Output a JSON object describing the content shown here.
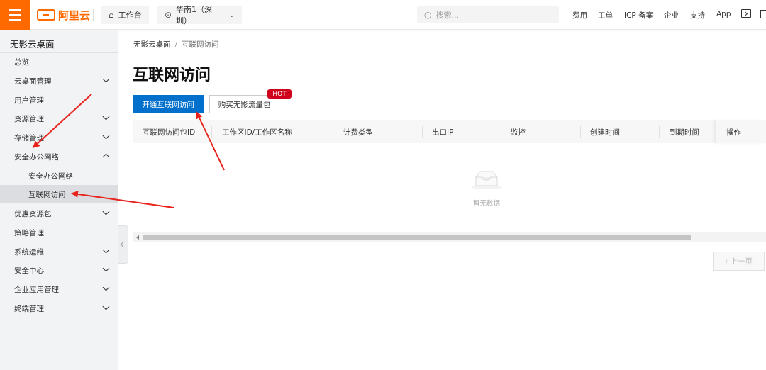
{
  "topbar": {
    "logo_text": "阿里云",
    "workbench_label": "工作台",
    "region_label": "华南1（深圳）",
    "search_placeholder": "搜索...",
    "links": [
      "费用",
      "工单",
      "ICP 备案",
      "企业",
      "支持",
      "App"
    ],
    "brand_color": "#ff6a00"
  },
  "sidebar": {
    "title": "无影云桌面",
    "items": [
      {
        "label": "总览",
        "arrow": "none"
      },
      {
        "label": "云桌面管理",
        "arrow": "down"
      },
      {
        "label": "用户管理",
        "arrow": "none"
      },
      {
        "label": "资源管理",
        "arrow": "down"
      },
      {
        "label": "存储管理",
        "arrow": "down"
      },
      {
        "label": "安全办公网络",
        "arrow": "up"
      },
      {
        "label": "安全办公网络",
        "sub": true
      },
      {
        "label": "互联网访问",
        "sub": true,
        "active": true
      },
      {
        "label": "优惠资源包",
        "arrow": "down"
      },
      {
        "label": "策略管理",
        "arrow": "none"
      },
      {
        "label": "系统运维",
        "arrow": "down"
      },
      {
        "label": "安全中心",
        "arrow": "down"
      },
      {
        "label": "企业应用管理",
        "arrow": "down"
      },
      {
        "label": "终端管理",
        "arrow": "down"
      }
    ]
  },
  "breadcrumb": {
    "root": "无影云桌面",
    "separator": "/",
    "current": "互联网访问"
  },
  "page": {
    "title": "互联网访问",
    "primary_button": "开通互联网访问",
    "secondary_button": "购买无影流量包",
    "badge": "HOT",
    "primary_color": "#0070cc",
    "badge_color": "#d0021b"
  },
  "table": {
    "columns": [
      "互联网访问包ID",
      "工作区ID/工作区名称",
      "计费类型",
      "出口IP",
      "监控",
      "创建时间",
      "到期时间",
      "操作"
    ],
    "empty_text": "暂无数据"
  },
  "pagination": {
    "prev_label": "‹ 上一页"
  },
  "annotations": {
    "arrow_color": "#e8231c"
  }
}
